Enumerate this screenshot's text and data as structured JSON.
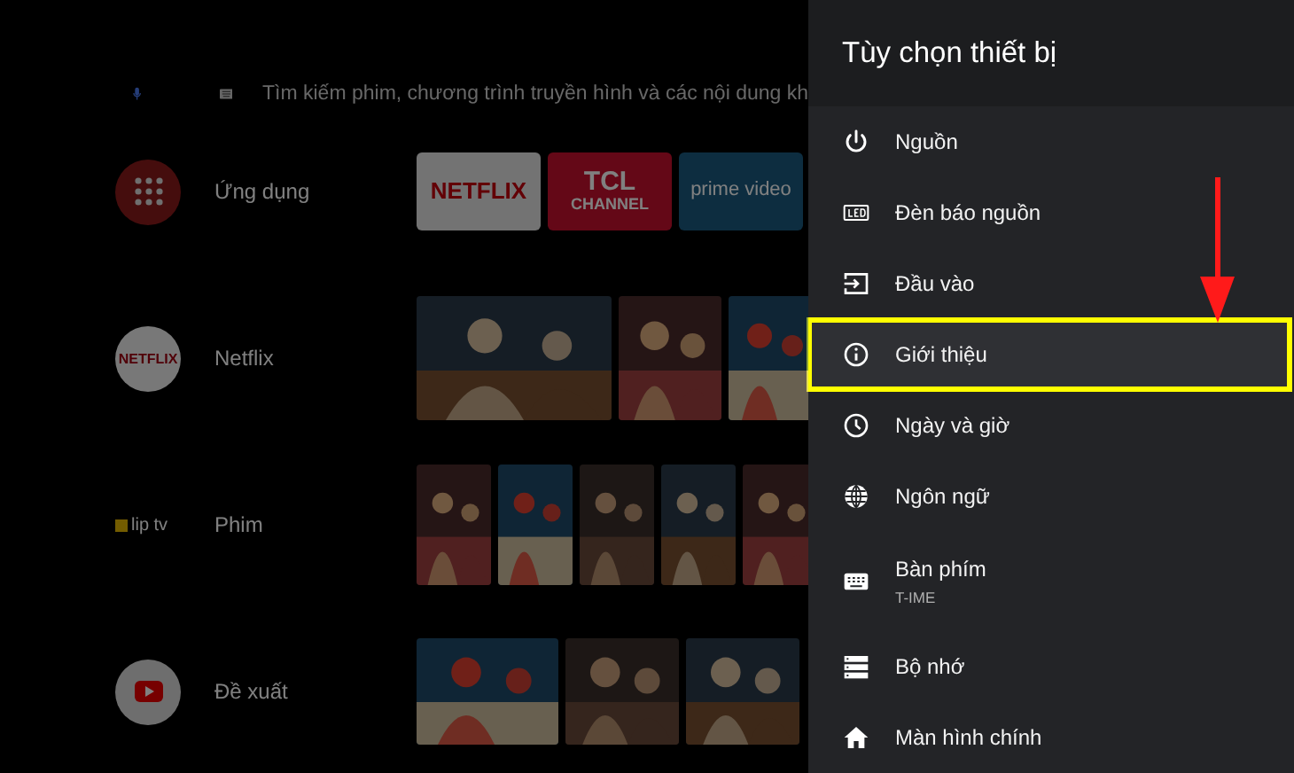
{
  "search": {
    "placeholder": "Tìm kiếm phim, chương trình truyền hình và các nội dung kh"
  },
  "rows": [
    {
      "kind": "apps",
      "label": "Ứng dụng",
      "tiles": [
        {
          "kind": "netflix",
          "text": "NETFLIX"
        },
        {
          "kind": "tcl",
          "lines": [
            "TCL",
            "CHANNEL"
          ]
        },
        {
          "kind": "prime",
          "text": "prime video"
        }
      ]
    },
    {
      "kind": "netflix",
      "logo_text": "NETFLIX",
      "label": "Netflix"
    },
    {
      "kind": "clip",
      "logo_text": "lip tv",
      "label": "Phim"
    },
    {
      "kind": "youtube",
      "label": "Đề xuất"
    }
  ],
  "panel": {
    "title": "Tùy chọn thiết bị",
    "items": [
      {
        "label": "Nguồn",
        "selected": false
      },
      {
        "label": "Đèn báo nguồn",
        "selected": false
      },
      {
        "label": "Đầu vào",
        "selected": false
      },
      {
        "label": "Giới thiệu",
        "selected": true
      },
      {
        "label": "Ngày và giờ",
        "selected": false
      },
      {
        "label": "Ngôn ngữ",
        "selected": false
      },
      {
        "label": "Bàn phím",
        "subtitle": "T-IME",
        "selected": false
      },
      {
        "label": "Bộ nhớ",
        "selected": false
      },
      {
        "label": "Màn hình chính",
        "selected": false
      }
    ]
  }
}
